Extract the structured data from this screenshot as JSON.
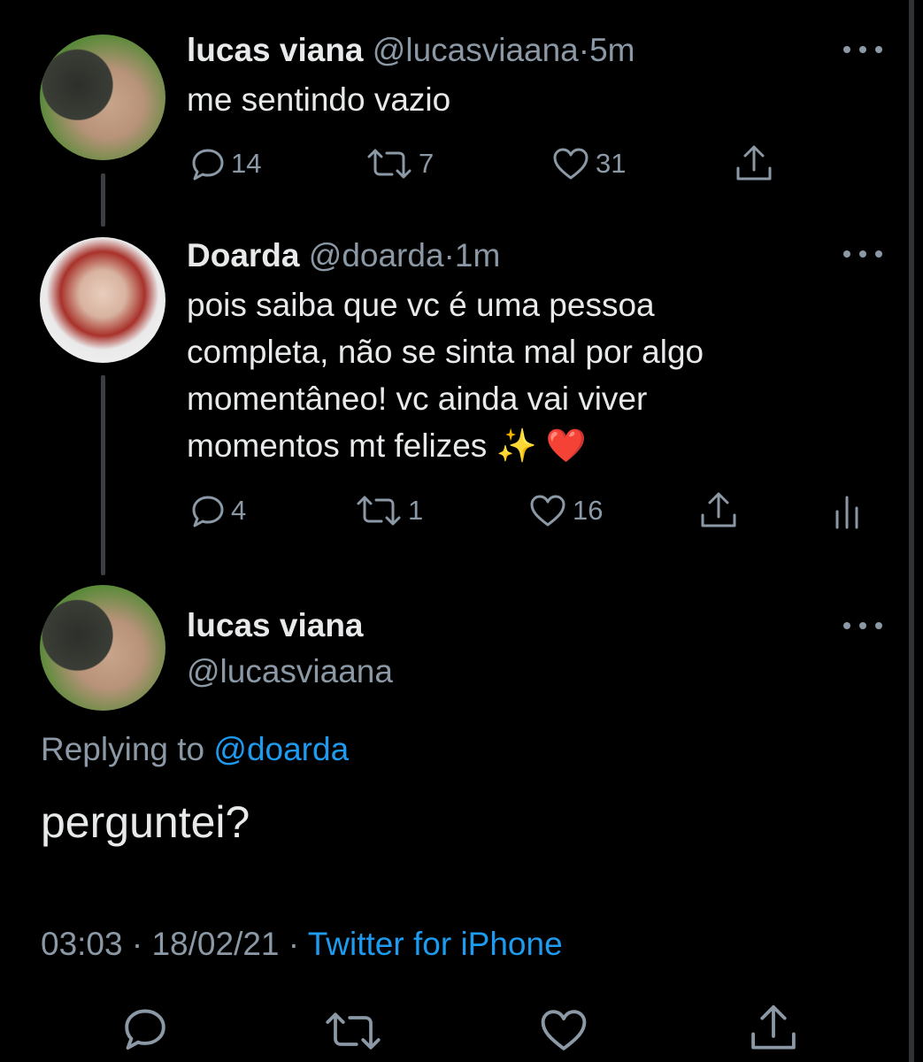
{
  "tweet1": {
    "name": "lucas viana",
    "handle": "@lucasviaana",
    "sep": "·",
    "time": "5m",
    "text": "me sentindo vazio",
    "replies": "14",
    "retweets": "7",
    "likes": "31"
  },
  "tweet2": {
    "name": "Doarda",
    "handle": "@doarda",
    "sep": "·",
    "time": "1m",
    "lines": [
      "pois saiba que vc é uma pessoa",
      "completa, não se sinta mal por algo",
      "momentâneo! vc ainda vai viver",
      "momentos mt felizes ✨ ❤️"
    ],
    "replies": "4",
    "retweets": "1",
    "likes": "16"
  },
  "tweet3": {
    "name": "lucas viana",
    "handle": "@lucasviaana",
    "replying_prefix": "Replying to",
    "replying_handle": "@doarda",
    "text": "perguntei?",
    "time": "03:03",
    "sep1": "·",
    "date": "18/02/21",
    "sep2": "·",
    "source": "Twitter for iPhone"
  },
  "colors": {
    "background": "#000000",
    "text": "#e7e9ea",
    "muted": "#8b98a5",
    "link": "#1d9bf0"
  },
  "icons": [
    "reply-icon",
    "retweet-icon",
    "like-icon",
    "share-icon",
    "analytics-icon",
    "more-icon"
  ]
}
